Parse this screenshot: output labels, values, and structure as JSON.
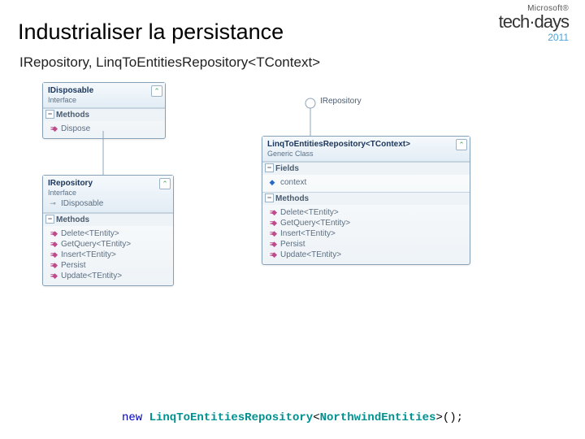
{
  "brand": {
    "ms": "Microsoft®",
    "name": "tech·days",
    "year": "2011"
  },
  "title": "Industrialiser la persistance",
  "subtitle": "IRepository, LinqToEntitiesRepository<TContext>",
  "idisposable": {
    "name": "IDisposable",
    "stereo": "Interface",
    "sections": {
      "methods_label": "Methods",
      "methods": [
        "Dispose"
      ]
    }
  },
  "irepository_left": {
    "name": "IRepository",
    "stereo": "Interface",
    "implements_label": "IDisposable",
    "sections": {
      "methods_label": "Methods",
      "methods": [
        "Delete<TEntity>",
        "GetQuery<TEntity>",
        "Insert<TEntity>",
        "Persist",
        "Update<TEntity>"
      ]
    }
  },
  "irepository_lollipop": "IRepository",
  "linq_repo": {
    "name": "LinqToEntitiesRepository<TContext>",
    "stereo": "Generic Class",
    "sections": {
      "fields_label": "Fields",
      "fields": [
        "context"
      ],
      "methods_label": "Methods",
      "methods": [
        "Delete<TEntity>",
        "GetQuery<TEntity>",
        "Insert<TEntity>",
        "Persist",
        "Update<TEntity>"
      ]
    }
  },
  "code": {
    "kw": "new",
    "type_outer": "LinqToEntitiesRepository",
    "lt": "<",
    "type_inner": "NorthwindEntities",
    "gt": ">",
    "tail": "();"
  }
}
